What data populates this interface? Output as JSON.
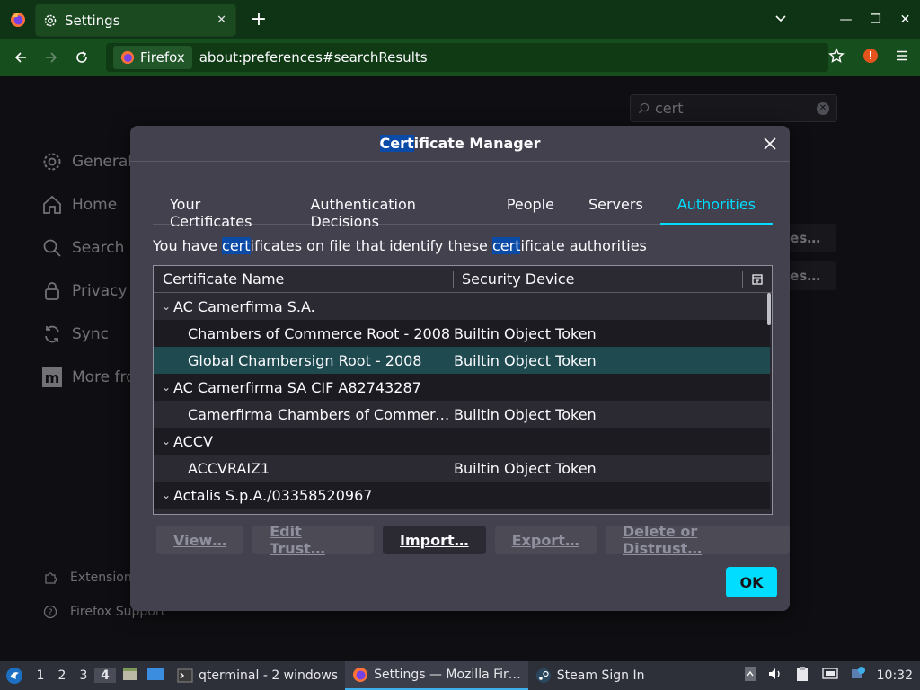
{
  "browser": {
    "tab_title": "Settings",
    "identity_label": "Firefox",
    "url": "about:preferences#searchResults"
  },
  "settings_page": {
    "search_value": "cert",
    "categories": [
      "General",
      "Home",
      "Search",
      "Privacy",
      "Sync",
      "More fro"
    ],
    "bg_buttons": [
      "tes…",
      "tes…"
    ],
    "footer_links": [
      "Extension",
      "Firefox Support"
    ]
  },
  "dialog": {
    "title_highlight": "Cert",
    "title_rest": "ificate Manager",
    "tabs": [
      "Your Certificates",
      "Authentication Decisions",
      "People",
      "Servers",
      "Authorities"
    ],
    "active_tab": "Authorities",
    "description_parts": [
      "You have ",
      "cert",
      "ificates on file that identify these ",
      "cert",
      "ificate authorities"
    ],
    "columns": {
      "name": "Certificate Name",
      "device": "Security Device"
    },
    "rows": [
      {
        "type": "group",
        "name": "AC Camerfirma S.A.",
        "device": ""
      },
      {
        "type": "child",
        "name": "Chambers of Commerce Root - 2008",
        "device": "Builtin Object Token"
      },
      {
        "type": "child",
        "name": "Global Chambersign Root - 2008",
        "device": "Builtin Object Token",
        "selected": true
      },
      {
        "type": "group",
        "name": "AC Camerfirma SA CIF A82743287",
        "device": ""
      },
      {
        "type": "child",
        "name": "Camerfirma Chambers of Commerce…",
        "device": "Builtin Object Token"
      },
      {
        "type": "group",
        "name": "ACCV",
        "device": ""
      },
      {
        "type": "child",
        "name": "ACCVRAIZ1",
        "device": "Builtin Object Token"
      },
      {
        "type": "group",
        "name": "Actalis S.p.A./03358520967",
        "device": ""
      }
    ],
    "buttons": {
      "view": "View…",
      "edit_trust": "Edit Trust…",
      "import": "Import…",
      "export": "Export…",
      "delete": "Delete or Distrust…"
    },
    "ok_label": "OK"
  },
  "taskbar": {
    "desktops": [
      "1",
      "2",
      "3",
      "4"
    ],
    "current_desktop": "4",
    "tasks": [
      "qterminal - 2 windows",
      "Settings — Mozilla Fir…",
      "Steam Sign In"
    ],
    "clock": "10:32"
  },
  "colors": {
    "accent": "#00ddff",
    "tabstrip": "#0f3415",
    "navbar": "#174e1e",
    "highlight": "#0a4ba8"
  }
}
